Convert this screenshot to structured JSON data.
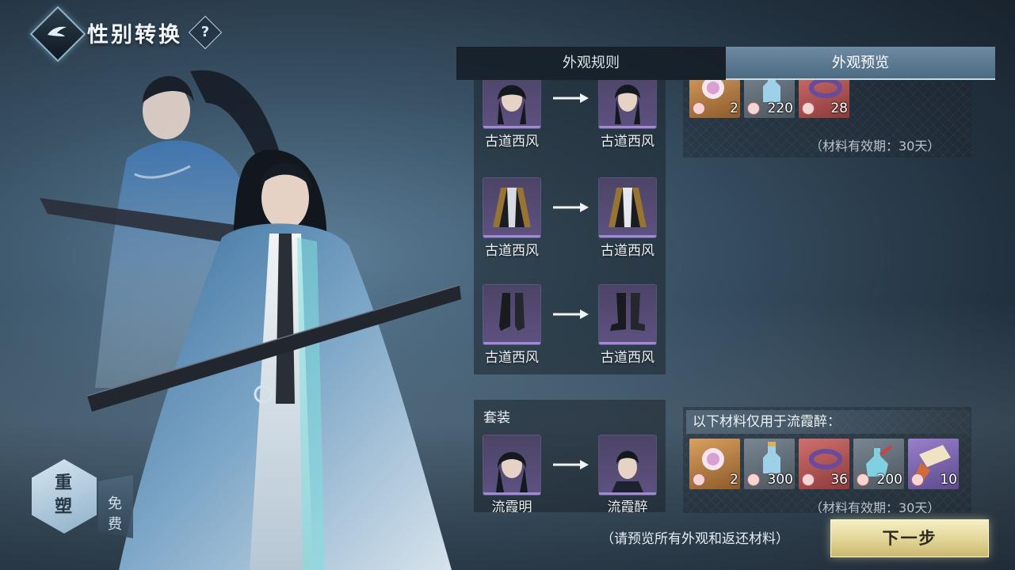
{
  "header": {
    "title": "性别转换",
    "help_label": "?"
  },
  "tabs": [
    {
      "label": "外观规则",
      "active": false
    },
    {
      "label": "外观预览",
      "active": true
    }
  ],
  "appearance_rows": [
    {
      "from_name": "古道西风",
      "to_name": "古道西风",
      "from_icon": "female-head-icon",
      "to_icon": "male-head-icon"
    },
    {
      "from_name": "古道西风",
      "to_name": "古道西风",
      "from_icon": "robe-icon",
      "to_icon": "robe-icon"
    },
    {
      "from_name": "古道西风",
      "to_name": "古道西风",
      "from_icon": "boots-icon",
      "to_icon": "boots-icon"
    }
  ],
  "set_section": {
    "label": "套装",
    "from_name": "流霞明",
    "to_name": "流霞醉"
  },
  "materials_top": {
    "items": [
      {
        "qty": "2",
        "rarity": "gold",
        "icon": "orb-icon"
      },
      {
        "qty": "220",
        "rarity": "grey",
        "icon": "bottle-icon"
      },
      {
        "qty": "28",
        "rarity": "red",
        "icon": "ring-icon"
      }
    ],
    "validity": "（材料有效期：30天）"
  },
  "materials_bottom": {
    "header": "以下材料仅用于流霞醉：",
    "items": [
      {
        "qty": "2",
        "rarity": "gold",
        "icon": "orb-icon"
      },
      {
        "qty": "300",
        "rarity": "grey",
        "icon": "bottle-icon"
      },
      {
        "qty": "36",
        "rarity": "red",
        "icon": "ring-icon"
      },
      {
        "qty": "200",
        "rarity": "grey",
        "icon": "potion-icon"
      },
      {
        "qty": "10",
        "rarity": "purple",
        "icon": "scroll-icon"
      }
    ],
    "validity": "（材料有效期：30天）"
  },
  "footer": {
    "hint": "（请预览所有外观和返还材料）",
    "next_label": "下一步"
  },
  "reshape": {
    "label_top": "重",
    "label_bottom": "塑",
    "free_top": "免",
    "free_bottom": "费"
  },
  "colors": {
    "accent": "#4c6a82",
    "button_gold": "#e2d496",
    "slot_purple": "#5d5180"
  }
}
